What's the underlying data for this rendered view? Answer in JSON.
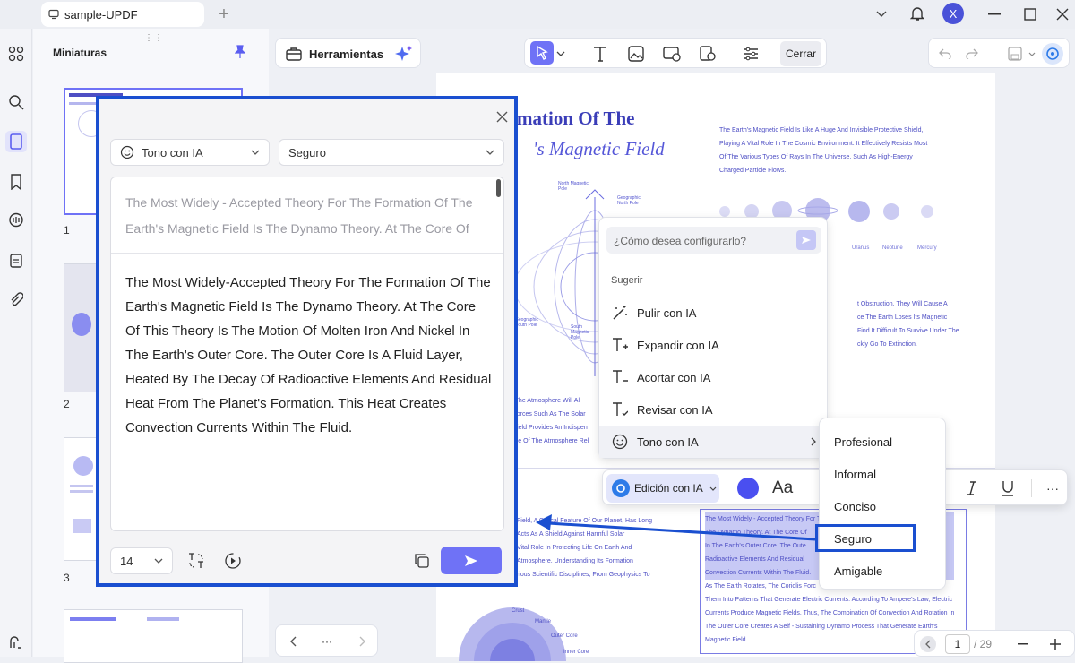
{
  "window": {
    "tab_title": "sample-UPDF",
    "user_initial": "X"
  },
  "sidebar": {
    "title": "Miniaturas",
    "pages": [
      "1",
      "2",
      "3"
    ]
  },
  "toolbar": {
    "tools_label": "Herramientas",
    "close_label": "Cerrar"
  },
  "document": {
    "heading_line1": "mation Of The",
    "heading_line2": "'s Magnetic Field",
    "intro": [
      "The Earth's Magnetic Field Is Like A Huge And Invisible Protective Shield,",
      "Playing A Vital Role In The Cosmic Environment. It Effectively Resists Most",
      "Of The Various Types Of Rays In The Universe, Such As High-Energy",
      "Charged Particle Flows."
    ],
    "planet_labels": [
      "Uranus",
      "Neptune",
      "Mercury"
    ],
    "diagram_labels": {
      "north": "North Magnetic Pole",
      "geo_north": "Geographic North Pole",
      "geo_south": "Geographic South Pole",
      "south": "South Magnetic Pole"
    },
    "right_para": [
      "t Obstruction, They Will Cause A",
      "ce The Earth Loses Its Magnetic",
      "Find It Difficult To Survive Under The",
      "ckly Go To Extinction."
    ],
    "left_para": [
      "e, The Atmosphere Will Al",
      "y Forces Such As The Solar",
      "h Field Provides An Indispen",
      "ence Of The Atmosphere Rel"
    ],
    "lower_left_para": [
      "Field, A Critical Feature Of Our Planet, Has Long",
      "Acts As A Shield Against Harmful Solar",
      "Vital Role In Protecting Life On Earth And",
      "Atmosphere. Understanding Its Formation",
      "rious Scientific Disciplines, From Geophysics To"
    ],
    "selected_para": [
      "The Most Widely - Accepted Theory For The",
      "The Dynamo Theory. At The Core Of",
      "In The Earth's Outer Core. The Oute",
      "Radioactive Elements And Residual",
      "Convection Currents Within The Fluid.",
      "As The Earth Rotates, The Coriolis Forc",
      "Them Into Patterns That Generate Electric Currents. According To Ampere's Law, Electric",
      "Currents Produce Magnetic Fields. Thus, The Combination Of Convection And Rotation In",
      "The Outer Core Creates A Self - Sustaining Dynamo Process That Generate Earth's",
      "Magnetic Field."
    ],
    "layers": [
      "Crust",
      "Mantle",
      "Outer Core",
      "Inner Core"
    ]
  },
  "ai_popup": {
    "tone_select": "Tono con IA",
    "style_select": "Seguro",
    "original_text": "The Most Widely - Accepted Theory For The Formation Of The Earth's Magnetic Field Is The Dynamo Theory. At The Core Of",
    "result_text": "The Most Widely-Accepted Theory For The Formation Of The Earth's Magnetic Field Is The Dynamo Theory. At The Core Of This Theory Is The Motion Of Molten Iron And Nickel In The Earth's Outer Core. The Outer Core Is A Fluid Layer, Heated By The Decay Of Radioactive Elements And Residual Heat From The Planet's Formation. This Heat Creates Convection Currents Within The Fluid.",
    "font_size": "14"
  },
  "ai_menu": {
    "prompt_placeholder": "¿Cómo desea configurarlo?",
    "suggest_label": "Sugerir",
    "items": [
      "Pulir con IA",
      "Expandir con IA",
      "Acortar con IA",
      "Revisar con IA",
      "Tono con IA"
    ]
  },
  "tone_menu": {
    "items": [
      "Profesional",
      "Informal",
      "Conciso",
      "Seguro",
      "Amigable"
    ]
  },
  "edit_bar": {
    "ai_edit_label": "Edición con IA",
    "font_label": "Aa",
    "accent": "#4a4ff0"
  },
  "pagination": {
    "current": "1",
    "total": "/ 29"
  },
  "colors": {
    "accent": "#6f72f6",
    "highlight_border": "#1a4fd0",
    "doc_text": "#4e4fc4"
  }
}
